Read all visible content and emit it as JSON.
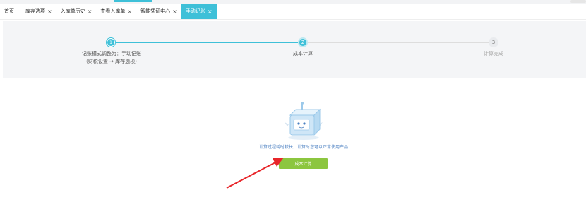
{
  "tabs": [
    {
      "label": "首页",
      "closable": false
    },
    {
      "label": "库存选项",
      "closable": true
    },
    {
      "label": "入库单历史",
      "closable": true
    },
    {
      "label": "查看入库单",
      "closable": true
    },
    {
      "label": "智能凭证中心",
      "closable": true
    },
    {
      "label": "手动记账",
      "closable": true,
      "active": true
    }
  ],
  "close_glyph": "×",
  "steps": [
    {
      "number": "1",
      "status": "done",
      "label_line1": "记账模式调整为：手动记账",
      "label_line2": "（财税设置 → 库存选项）"
    },
    {
      "number": "2",
      "status": "current",
      "label_line1": "成本计算"
    },
    {
      "number": "3",
      "status": "todo",
      "label_line1": "计算完成"
    }
  ],
  "main": {
    "hint": "计算过程耗时较长，计算时您可以正常使用产品",
    "calc_button": "成本计算"
  },
  "colors": {
    "accent": "#3ec0d8",
    "button": "#8cc63f",
    "annotation_arrow": "#e8262a"
  }
}
